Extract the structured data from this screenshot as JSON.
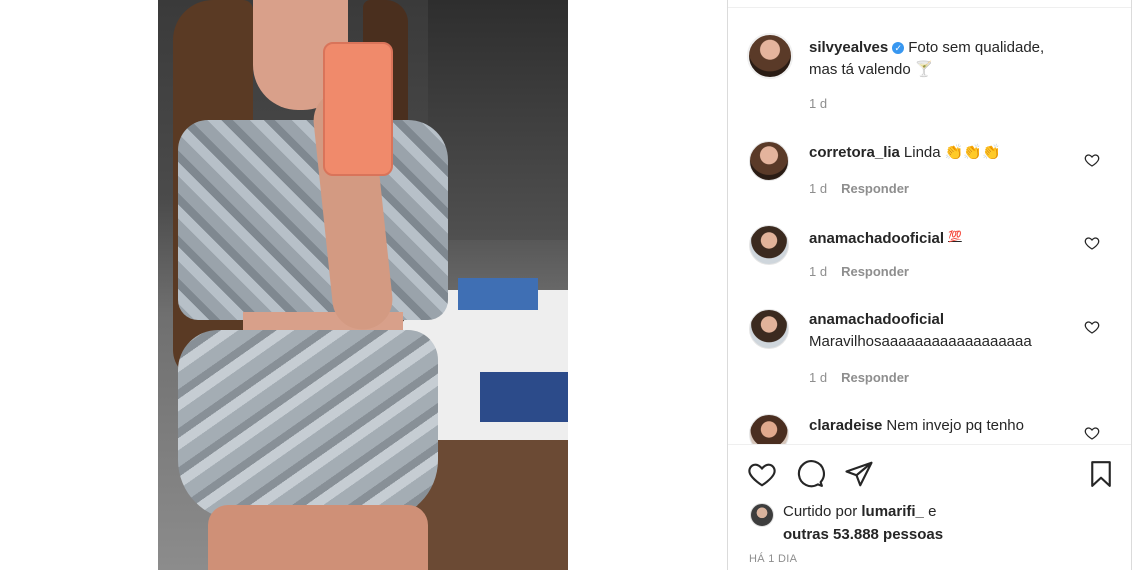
{
  "post": {
    "caption": {
      "username": "silvyealves",
      "verified_glyph": "✓",
      "text_line1": "Foto sem qualidade,",
      "text_line2": "mas tá valendo 🍸",
      "age": "1 d"
    },
    "reply_label": "Responder",
    "comments": [
      {
        "username": "corretora_lia",
        "text": "Linda 👏👏👏",
        "age": "1 d"
      },
      {
        "username": "anamachadooficial",
        "text": "💯",
        "age": "1 d"
      },
      {
        "username": "anamachadooficial",
        "text": "Maravilhosaaaaaaaaaaaaaaaaaa",
        "age": "1 d"
      },
      {
        "username": "claradeise",
        "text": "Nem invejo pq tenho",
        "age": ""
      }
    ],
    "actions": {
      "like_icon": "heart-icon",
      "comment_icon": "comment-icon",
      "share_icon": "send-icon",
      "save_icon": "bookmark-icon"
    },
    "likes": {
      "prefix": "Curtido por",
      "user": "lumarifi_",
      "connector": "e",
      "others": "outras 53.888 pessoas"
    },
    "date": "HÁ 1 DIA"
  },
  "colors": {
    "text": "#262626",
    "muted": "#8e8e8e",
    "verified": "#3897f0",
    "border": "#dbdbdb"
  }
}
